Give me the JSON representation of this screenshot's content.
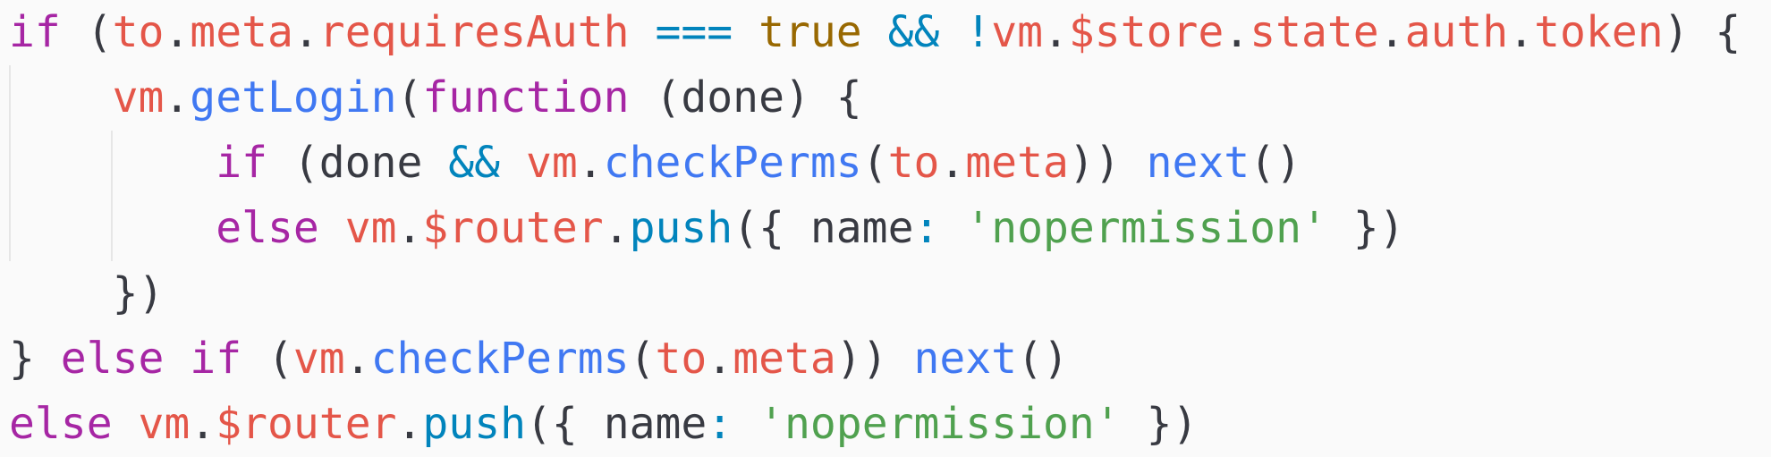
{
  "code_lines": [
    [
      {
        "t": "if",
        "c": "k"
      },
      {
        "t": " (",
        "c": "p"
      },
      {
        "t": "to",
        "c": "v"
      },
      {
        "t": ".",
        "c": "p"
      },
      {
        "t": "meta",
        "c": "v"
      },
      {
        "t": ".",
        "c": "p"
      },
      {
        "t": "requiresAuth",
        "c": "v"
      },
      {
        "t": " ",
        "c": "p"
      },
      {
        "t": "===",
        "c": "o"
      },
      {
        "t": " ",
        "c": "p"
      },
      {
        "t": "true",
        "c": "b"
      },
      {
        "t": " ",
        "c": "p"
      },
      {
        "t": "&&",
        "c": "o"
      },
      {
        "t": " ",
        "c": "p"
      },
      {
        "t": "!",
        "c": "o"
      },
      {
        "t": "vm",
        "c": "v"
      },
      {
        "t": ".",
        "c": "p"
      },
      {
        "t": "$store",
        "c": "v"
      },
      {
        "t": ".",
        "c": "p"
      },
      {
        "t": "state",
        "c": "v"
      },
      {
        "t": ".",
        "c": "p"
      },
      {
        "t": "auth",
        "c": "v"
      },
      {
        "t": ".",
        "c": "p"
      },
      {
        "t": "token",
        "c": "v"
      },
      {
        "t": ") {",
        "c": "p"
      }
    ],
    [
      {
        "t": "    ",
        "c": "p"
      },
      {
        "t": "vm",
        "c": "v"
      },
      {
        "t": ".",
        "c": "p"
      },
      {
        "t": "getLogin",
        "c": "f"
      },
      {
        "t": "(",
        "c": "p"
      },
      {
        "t": "function",
        "c": "k"
      },
      {
        "t": " (done) {",
        "c": "p"
      }
    ],
    [
      {
        "t": "        ",
        "c": "p"
      },
      {
        "t": "if",
        "c": "k"
      },
      {
        "t": " (done ",
        "c": "p"
      },
      {
        "t": "&&",
        "c": "o"
      },
      {
        "t": " ",
        "c": "p"
      },
      {
        "t": "vm",
        "c": "v"
      },
      {
        "t": ".",
        "c": "p"
      },
      {
        "t": "checkPerms",
        "c": "f"
      },
      {
        "t": "(",
        "c": "p"
      },
      {
        "t": "to",
        "c": "v"
      },
      {
        "t": ".",
        "c": "p"
      },
      {
        "t": "meta",
        "c": "v"
      },
      {
        "t": ")) ",
        "c": "p"
      },
      {
        "t": "next",
        "c": "f"
      },
      {
        "t": "()",
        "c": "p"
      }
    ],
    [
      {
        "t": "        ",
        "c": "p"
      },
      {
        "t": "else",
        "c": "k"
      },
      {
        "t": " ",
        "c": "p"
      },
      {
        "t": "vm",
        "c": "v"
      },
      {
        "t": ".",
        "c": "p"
      },
      {
        "t": "$router",
        "c": "v"
      },
      {
        "t": ".",
        "c": "p"
      },
      {
        "t": "push",
        "c": "o"
      },
      {
        "t": "({ name",
        "c": "p"
      },
      {
        "t": ":",
        "c": "o"
      },
      {
        "t": " ",
        "c": "p"
      },
      {
        "t": "'nopermission'",
        "c": "s"
      },
      {
        "t": " })",
        "c": "p"
      }
    ],
    [
      {
        "t": "    })",
        "c": "p"
      }
    ],
    [
      {
        "t": "} ",
        "c": "p"
      },
      {
        "t": "else",
        "c": "k"
      },
      {
        "t": " ",
        "c": "p"
      },
      {
        "t": "if",
        "c": "k"
      },
      {
        "t": " (",
        "c": "p"
      },
      {
        "t": "vm",
        "c": "v"
      },
      {
        "t": ".",
        "c": "p"
      },
      {
        "t": "checkPerms",
        "c": "f"
      },
      {
        "t": "(",
        "c": "p"
      },
      {
        "t": "to",
        "c": "v"
      },
      {
        "t": ".",
        "c": "p"
      },
      {
        "t": "meta",
        "c": "v"
      },
      {
        "t": ")) ",
        "c": "p"
      },
      {
        "t": "next",
        "c": "f"
      },
      {
        "t": "()",
        "c": "p"
      }
    ],
    [
      {
        "t": "else",
        "c": "k"
      },
      {
        "t": " ",
        "c": "p"
      },
      {
        "t": "vm",
        "c": "v"
      },
      {
        "t": ".",
        "c": "p"
      },
      {
        "t": "$router",
        "c": "v"
      },
      {
        "t": ".",
        "c": "p"
      },
      {
        "t": "push",
        "c": "o"
      },
      {
        "t": "({ name",
        "c": "p"
      },
      {
        "t": ":",
        "c": "o"
      },
      {
        "t": " ",
        "c": "p"
      },
      {
        "t": "'nopermission'",
        "c": "s"
      },
      {
        "t": " })",
        "c": "p"
      }
    ]
  ],
  "syntax_colors": {
    "keyword": "#a626a4",
    "variable": "#e45649",
    "function": "#4078f2",
    "operator": "#0184bc",
    "boolean": "#986801",
    "string": "#50a14f",
    "plain": "#383a42",
    "background": "#fafafa"
  }
}
